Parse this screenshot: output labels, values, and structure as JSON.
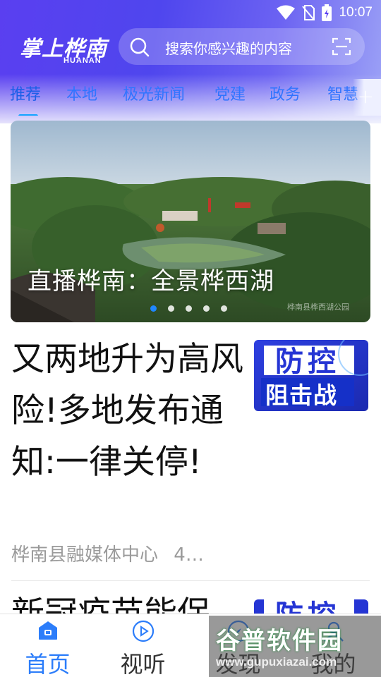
{
  "status_bar": {
    "time": "10:07"
  },
  "app": {
    "logo_main": "掌上桦南",
    "logo_sub": "HUANAN"
  },
  "search": {
    "placeholder": "搜索你感兴趣的内容"
  },
  "tabs": [
    {
      "label": "推荐"
    },
    {
      "label": "本地"
    },
    {
      "label": "极光新闻"
    },
    {
      "label": "党建"
    },
    {
      "label": "政务"
    },
    {
      "label": "智慧"
    }
  ],
  "tab_add_label": "+",
  "banner": {
    "title": "直播桦南：全景桦西湖",
    "caption": "桦南县桦西湖公园",
    "slide_count": 5,
    "active_slide": 1
  },
  "articles": [
    {
      "title": "又两地升为高风险!多地发布通知:一律关停!",
      "source": "桦南县融媒体中心",
      "meta_suffix": "4…",
      "thumb_text_top": "防控",
      "thumb_text_bottom": "阻击战"
    },
    {
      "title": "新冠疫苗能保",
      "thumb_text_top": "防控"
    }
  ],
  "bottom_nav": [
    {
      "label": "首页",
      "icon": "home-icon",
      "active": true
    },
    {
      "label": "视听",
      "icon": "play-icon",
      "active": false
    },
    {
      "label": "发现",
      "icon": "discover-icon",
      "active": false
    },
    {
      "label": "我的",
      "icon": "user-icon",
      "active": false
    }
  ],
  "site_watermark": {
    "title": "谷普软件园",
    "url": "www.gupuxiazai.com"
  },
  "colors": {
    "accent": "#2c7dfa",
    "header": "#5a3ff0",
    "tab": "#2f74ff"
  }
}
